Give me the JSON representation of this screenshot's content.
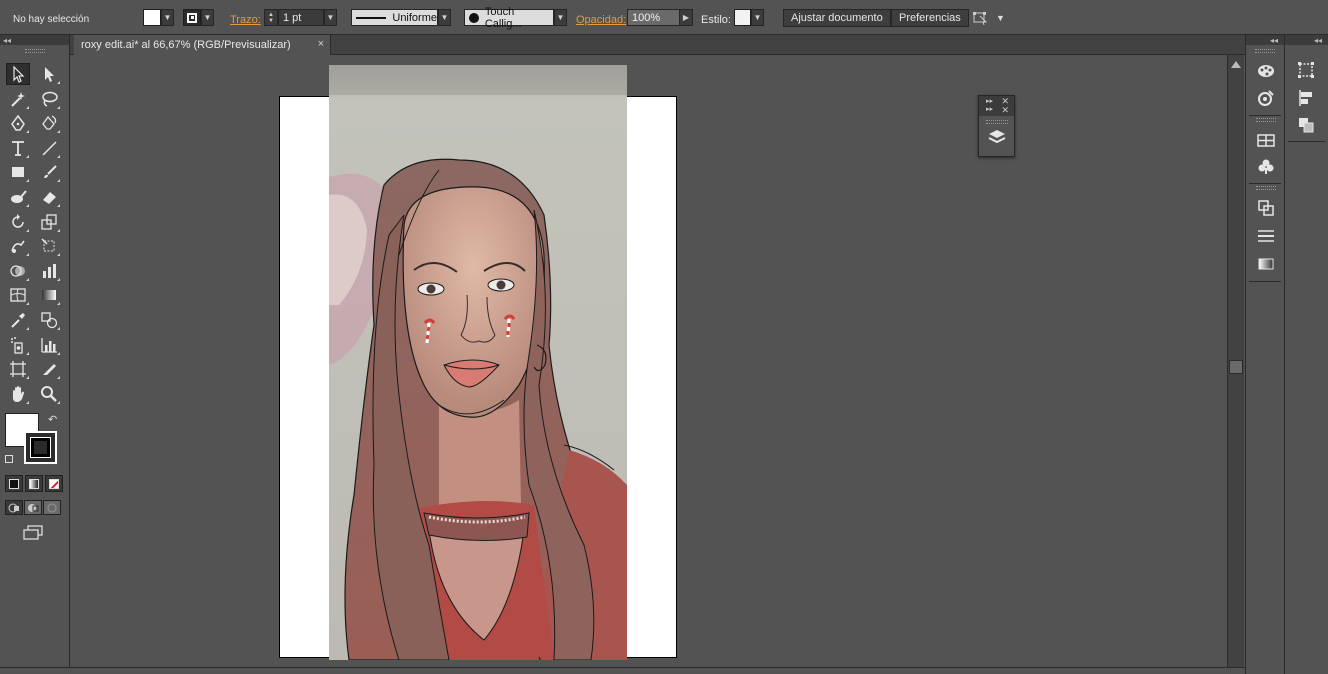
{
  "control_bar": {
    "selection_label": "No hay selección",
    "stroke_label": "Trazo:",
    "stroke_weight": "1 pt",
    "profile_label": "Uniforme",
    "brush_label": "Touch Callig...",
    "opacity_label": "Opacidad:",
    "opacity_value": "100%",
    "style_label": "Estilo:",
    "adjust_button": "Ajustar documento",
    "prefs_button": "Preferencias"
  },
  "document": {
    "tab_title": "roxy edit.ai* al 66,67% (RGB/Previsualizar)",
    "close_glyph": "×"
  },
  "colors": {
    "ui_background": "#535353",
    "ui_dark": "#424242",
    "accent_label": "#e59a3c",
    "fill_color": "#ffffff",
    "stroke_color": "#000000"
  },
  "tools": [
    "selection-icon",
    "direct-selection-icon",
    "magic-wand-icon",
    "lasso-icon",
    "pen-icon",
    "curvature-icon",
    "type-icon",
    "line-icon",
    "rectangle-icon",
    "paintbrush-icon",
    "blob-brush-icon",
    "eraser-icon",
    "rotate-icon",
    "scale-icon",
    "warp-icon",
    "free-transform-icon",
    "shape-builder-icon",
    "graph-icon",
    "mesh-icon",
    "gradient-icon",
    "eyedropper-icon",
    "blend-icon",
    "symbol-sprayer-icon",
    "column-graph-icon",
    "artboard-icon",
    "slice-icon",
    "hand-icon",
    "zoom-icon"
  ]
}
